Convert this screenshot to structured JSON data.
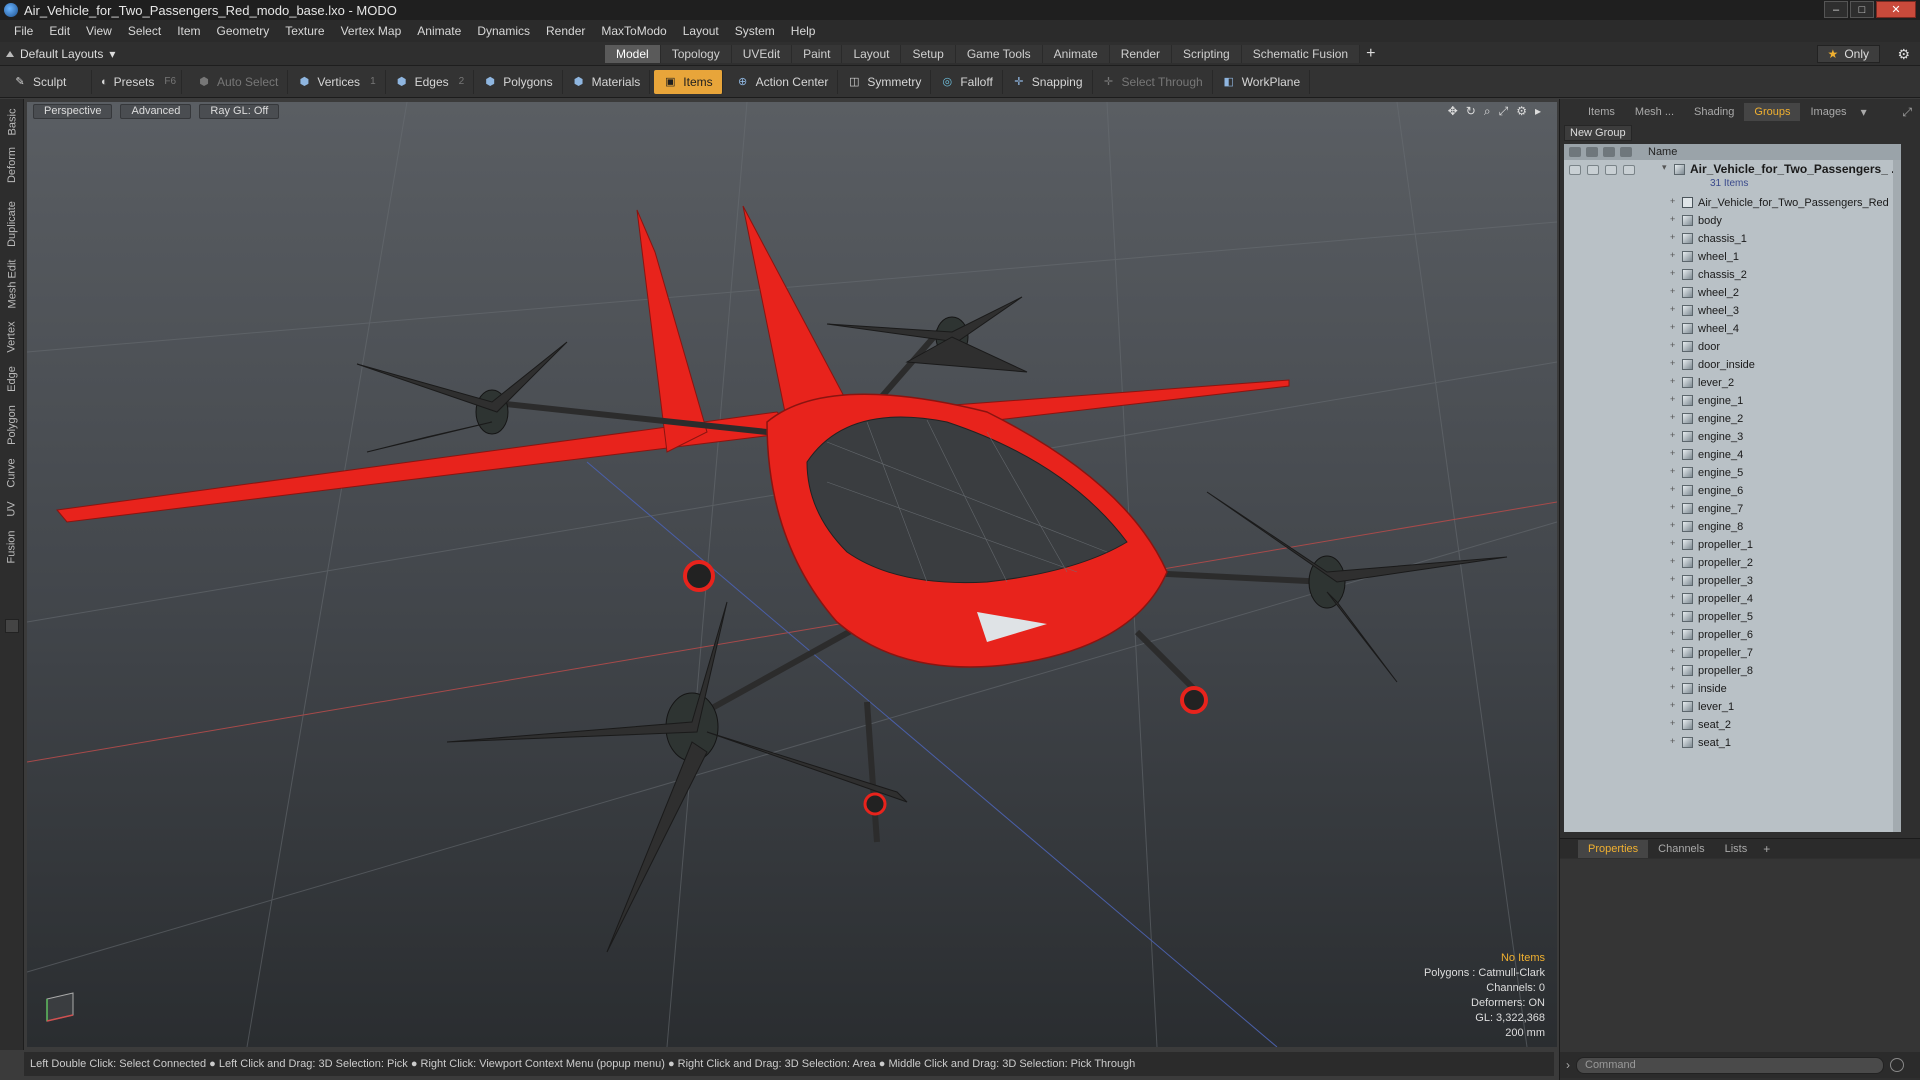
{
  "window": {
    "title": "Air_Vehicle_for_Two_Passengers_Red_modo_base.lxo - MODO",
    "controls": [
      "–",
      "□",
      "✕"
    ]
  },
  "menu": [
    "File",
    "Edit",
    "View",
    "Select",
    "Item",
    "Geometry",
    "Texture",
    "Vertex Map",
    "Animate",
    "Dynamics",
    "Render",
    "MaxToModo",
    "Layout",
    "System",
    "Help"
  ],
  "layout": {
    "selector": "Default Layouts",
    "tabs": [
      "Model",
      "Topology",
      "UVEdit",
      "Paint",
      "Layout",
      "Setup",
      "Game Tools",
      "Animate",
      "Render",
      "Scripting",
      "Schematic Fusion"
    ],
    "active_tab": "Model",
    "only_label": "Only"
  },
  "toolbar": {
    "sculpt": "Sculpt",
    "presets": "Presets",
    "presets_key": "F6",
    "auto_select": "Auto Select",
    "vertices": "Vertices",
    "vertices_key": "1",
    "edges": "Edges",
    "edges_key": "2",
    "polygons": "Polygons",
    "materials": "Materials",
    "items": "Items",
    "action_center": "Action Center",
    "symmetry": "Symmetry",
    "falloff": "Falloff",
    "snapping": "Snapping",
    "select_through": "Select Through",
    "workplane": "WorkPlane"
  },
  "left_tabs": [
    "Basic",
    "Deform",
    "Duplicate",
    "Mesh Edit",
    "Vertex",
    "Edge",
    "Polygon",
    "Curve",
    "UV",
    "Fusion"
  ],
  "viewport": {
    "view": "Perspective",
    "style": "Advanced",
    "raygl": "Ray GL: Off",
    "info": {
      "no_items": "No Items",
      "polygons": "Polygons : Catmull-Clark",
      "channels": "Channels: 0",
      "deformers": "Deformers: ON",
      "gl": "GL: 3,322,368",
      "scale": "200 mm"
    }
  },
  "status_bar": "Left Double Click: Select Connected ● Left Click and Drag: 3D Selection: Pick ● Right Click: Viewport Context Menu (popup menu) ● Right Click and Drag: 3D Selection: Area ● Middle Click and Drag: 3D Selection: Pick Through",
  "right_panel": {
    "tabs": [
      "Items",
      "Mesh ...",
      "Shading",
      "Groups",
      "Images"
    ],
    "active_tab": "Groups",
    "new_group": "New Group",
    "name_header": "Name",
    "root": {
      "label": "Air_Vehicle_for_Two_Passengers_ ...",
      "count": "31 Items"
    },
    "items": [
      "Air_Vehicle_for_Two_Passengers_Red",
      "body",
      "chassis_1",
      "wheel_1",
      "chassis_2",
      "wheel_2",
      "wheel_3",
      "wheel_4",
      "door",
      "door_inside",
      "lever_2",
      "engine_1",
      "engine_2",
      "engine_3",
      "engine_4",
      "engine_5",
      "engine_6",
      "engine_7",
      "engine_8",
      "propeller_1",
      "propeller_2",
      "propeller_3",
      "propeller_4",
      "propeller_5",
      "propeller_6",
      "propeller_7",
      "propeller_8",
      "inside",
      "lever_1",
      "seat_2",
      "seat_1"
    ],
    "props_tabs": [
      "Properties",
      "Channels",
      "Lists"
    ],
    "props_active": "Properties",
    "command_placeholder": "Command"
  },
  "colors": {
    "accent": "#e8a53a",
    "vehicle_red": "#e8231c"
  }
}
